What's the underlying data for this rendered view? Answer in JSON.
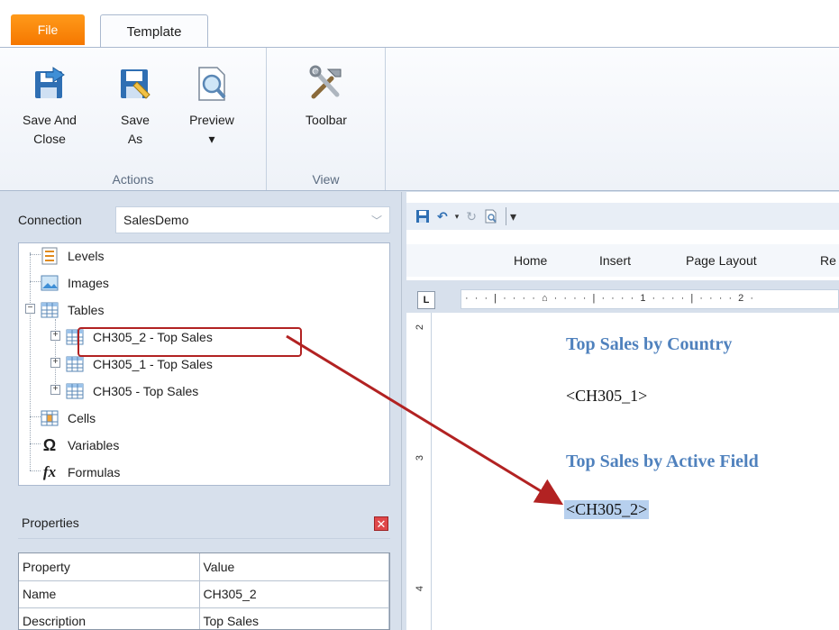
{
  "tabs": {
    "file": "File",
    "template": "Template"
  },
  "ribbon": {
    "actions_group": "Actions",
    "view_group": "View",
    "save_close": [
      "Save And",
      "Close"
    ],
    "save_as": [
      "Save",
      "As"
    ],
    "preview": "Preview",
    "preview_arrow": "▾",
    "toolbar": "Toolbar"
  },
  "connection": {
    "label": "Connection",
    "value": "SalesDemo"
  },
  "tree": {
    "levels": "Levels",
    "images": "Images",
    "tables": "Tables",
    "table_items": [
      "CH305_2 -  Top Sales",
      "CH305_1 -  Top Sales",
      "CH305 -  Top Sales"
    ],
    "cells": "Cells",
    "variables": "Variables",
    "formulas": "Formulas"
  },
  "properties": {
    "title": "Properties",
    "headers": [
      "Property",
      "Value"
    ],
    "rows": [
      [
        "Name",
        "CH305_2"
      ],
      [
        "Description",
        "Top Sales"
      ]
    ]
  },
  "word": {
    "tabs": [
      "Home",
      "Insert",
      "Page Layout",
      "Re"
    ],
    "ruler_text": "· · · | · · · · ⌂ · · · · | · · · · 1 · · · · | · · · · 2 ·",
    "vruler_numbers": [
      "2",
      "3",
      "4"
    ],
    "heading1": "Top Sales by Country",
    "para1": "<CH305_1>",
    "heading2": "Top Sales by Active Field",
    "para2": "<CH305_2>"
  },
  "colors": {
    "file_tab": "#f57700",
    "heading": "#4f81bd",
    "highlight_box": "#b22222",
    "selection": "#b7d0ee"
  }
}
